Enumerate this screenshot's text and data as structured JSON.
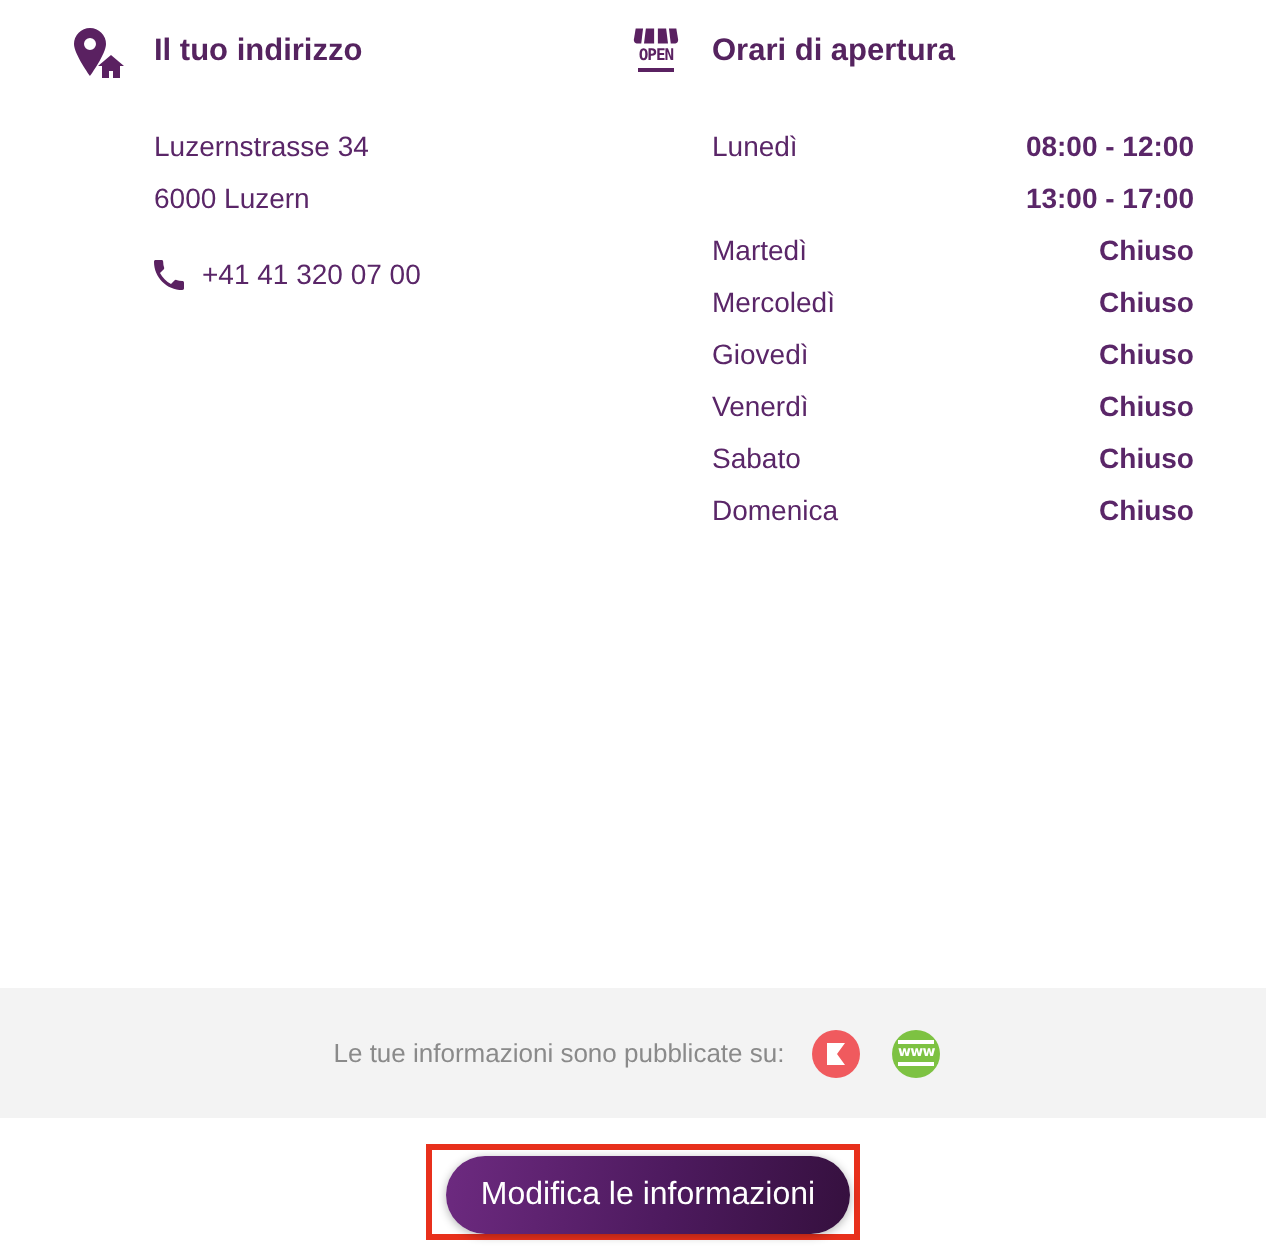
{
  "address": {
    "title": "Il tuo indirizzo",
    "lines": [
      "Luzernstrasse 34",
      "6000 Luzern"
    ],
    "phone": "+41 41 320 07 00"
  },
  "opening_hours": {
    "title": "Orari di apertura",
    "icon_text": "OPEN",
    "days": [
      {
        "day": "Lunedì",
        "times": [
          "08:00 - 12:00",
          "13:00 - 17:00"
        ]
      },
      {
        "day": "Martedì",
        "times": [
          "Chiuso"
        ]
      },
      {
        "day": "Mercoledì",
        "times": [
          "Chiuso"
        ]
      },
      {
        "day": "Giovedì",
        "times": [
          "Chiuso"
        ]
      },
      {
        "day": "Venerdì",
        "times": [
          "Chiuso"
        ]
      },
      {
        "day": "Sabato",
        "times": [
          "Chiuso"
        ]
      },
      {
        "day": "Domenica",
        "times": [
          "Chiuso"
        ]
      }
    ]
  },
  "published": {
    "text": "Le tue informazioni sono pubblicate su:",
    "platforms": [
      {
        "kind": "flag",
        "color": "#f05a5e"
      },
      {
        "kind": "web",
        "color": "#7dc242",
        "text": "www"
      }
    ]
  },
  "edit_button": {
    "label": "Modifica le informazioni",
    "highlighted": true
  }
}
